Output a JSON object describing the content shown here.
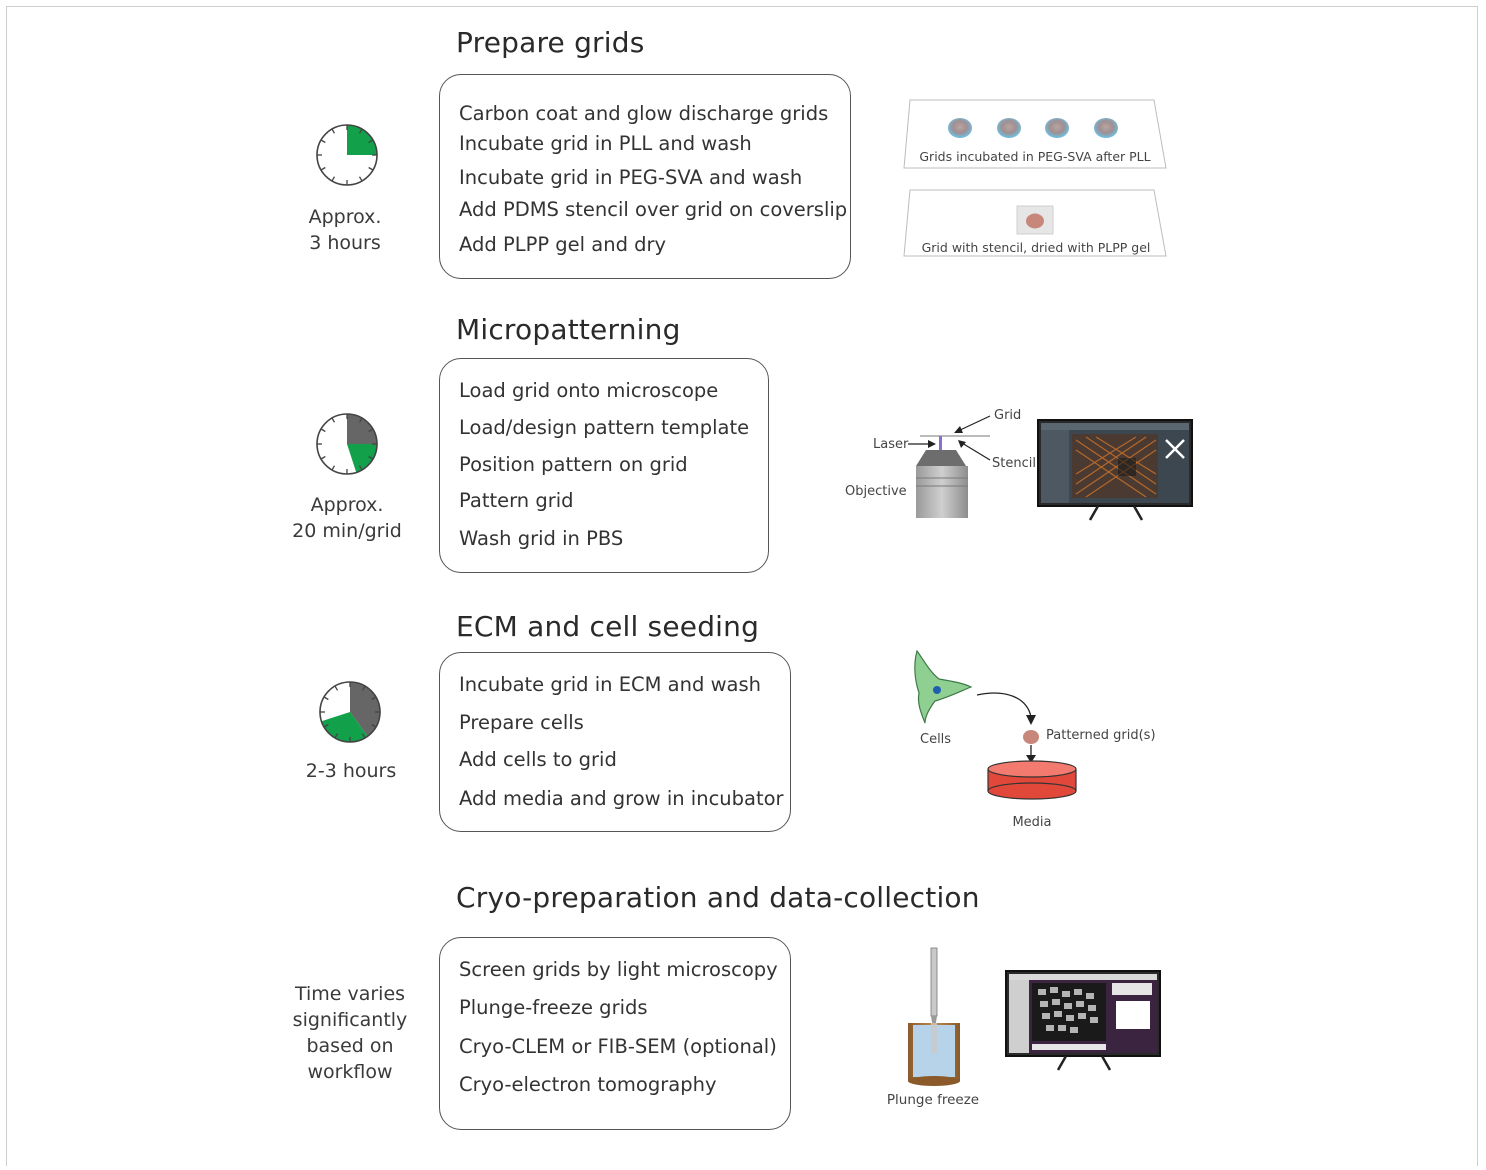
{
  "colors": {
    "clock_fill": "#12a04a",
    "clock_grey": "#666666",
    "media_red": "#e2483a",
    "cell_green": "#8fcf92",
    "grid_brown": "#c8877b",
    "droplet_blue": "#6cc3e6"
  },
  "sections": [
    {
      "title": "Prepare grids",
      "time_lines": [
        "Approx.",
        "3 hours"
      ],
      "clock": {
        "green_fraction": 0.25,
        "grey_fraction": 0
      },
      "steps": [
        "Carbon coat and glow discharge grids",
        "Incubate grid in PLL and wash",
        "Incubate grid in PEG-SVA and wash",
        "Add PDMS stencil over grid on coverslip",
        "Add PLPP gel and dry"
      ],
      "illustration": {
        "labels": [
          "Grids incubated in PEG-SVA after PLL",
          "Grid with stencil, dried with PLPP gel"
        ]
      }
    },
    {
      "title": "Micropatterning",
      "time_lines": [
        "Approx.",
        "20 min/grid"
      ],
      "clock": {
        "green_fraction": 0.2,
        "grey_fraction": 0.25
      },
      "steps": [
        "Load grid onto microscope",
        "Load/design pattern template",
        "Position pattern on grid",
        "Pattern grid",
        "Wash grid in PBS"
      ],
      "illustration": {
        "labels": [
          "Grid",
          "Laser",
          "Stencil",
          "Objective"
        ]
      }
    },
    {
      "title": "ECM and cell seeding",
      "time_lines": [
        "2-3 hours"
      ],
      "clock": {
        "green_fraction": 0.3,
        "grey_fraction": 0.4
      },
      "steps": [
        "Incubate grid in ECM and wash",
        "Prepare cells",
        "Add cells to grid",
        "Add media and grow in incubator"
      ],
      "illustration": {
        "labels": [
          "Cells",
          "Patterned grid(s)",
          "Media"
        ]
      }
    },
    {
      "title": "Cryo-preparation and data-collection",
      "time_lines": [
        "Time varies",
        "significantly",
        "based on",
        "workflow"
      ],
      "steps": [
        "Screen grids by light microscopy",
        "Plunge-freeze grids",
        "Cryo-CLEM or FIB-SEM (optional)",
        "Cryo-electron tomography"
      ],
      "illustration": {
        "labels": [
          "Plunge freeze"
        ]
      }
    }
  ]
}
